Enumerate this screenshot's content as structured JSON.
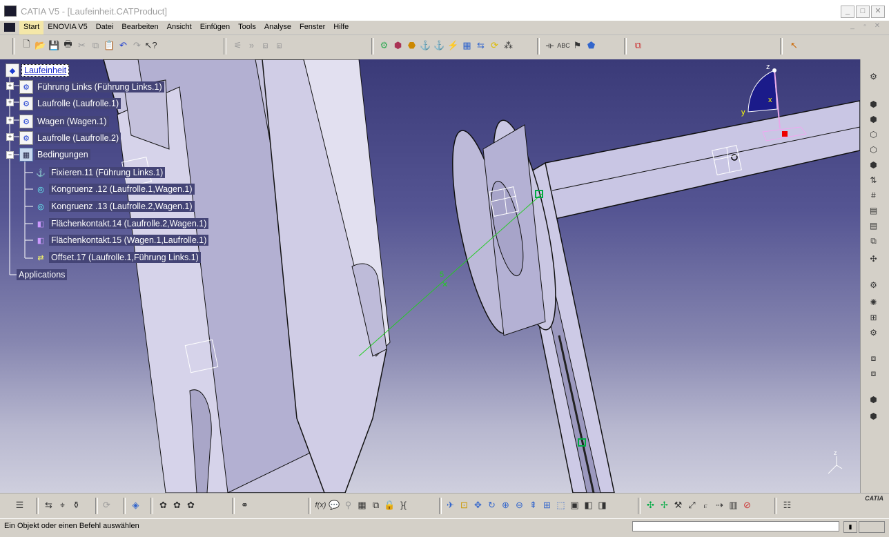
{
  "window": {
    "title": "CATIA V5 - [Laufeinheit.CATProduct]",
    "min": "_",
    "max": "□",
    "close": "✕"
  },
  "menu": {
    "items": [
      "Start",
      "ENOVIA V5",
      "Datei",
      "Bearbeiten",
      "Ansicht",
      "Einfügen",
      "Tools",
      "Analyse",
      "Fenster",
      "Hilfe"
    ],
    "active": "Start"
  },
  "tree": {
    "root": "Laufeinheit",
    "components": [
      "Führung Links (Führung Links.1)",
      "Laufrolle (Laufrolle.1)",
      "Wagen (Wagen.1)",
      "Laufrolle (Laufrolle.2)"
    ],
    "constraints_label": "Bedingungen",
    "constraints": [
      "Fixieren.11 (Führung Links.1)",
      "Kongruenz .12 (Laufrolle.1,Wagen.1)",
      "Kongruenz .13 (Laufrolle.2,Wagen.1)",
      "Flächenkontakt.14 (Laufrolle.2,Wagen.1)",
      "Flächenkontakt.15 (Wagen.1,Laufrolle.1)",
      "Offset.17 (Laufrolle.1,Führung Links.1)"
    ],
    "applications": "Applications"
  },
  "compass": {
    "z": "z",
    "y": "y",
    "x": "x"
  },
  "status": {
    "prompt": "Ein Objekt oder einen Befehl auswählen",
    "command_value": ""
  },
  "brand": {
    "logo_text": "CATIA"
  },
  "colors": {
    "viewport_top": "#3a3a78",
    "viewport_bottom": "#cfcfde",
    "tree_label_bg": "#444476",
    "constraint_line": "#22cc22"
  }
}
